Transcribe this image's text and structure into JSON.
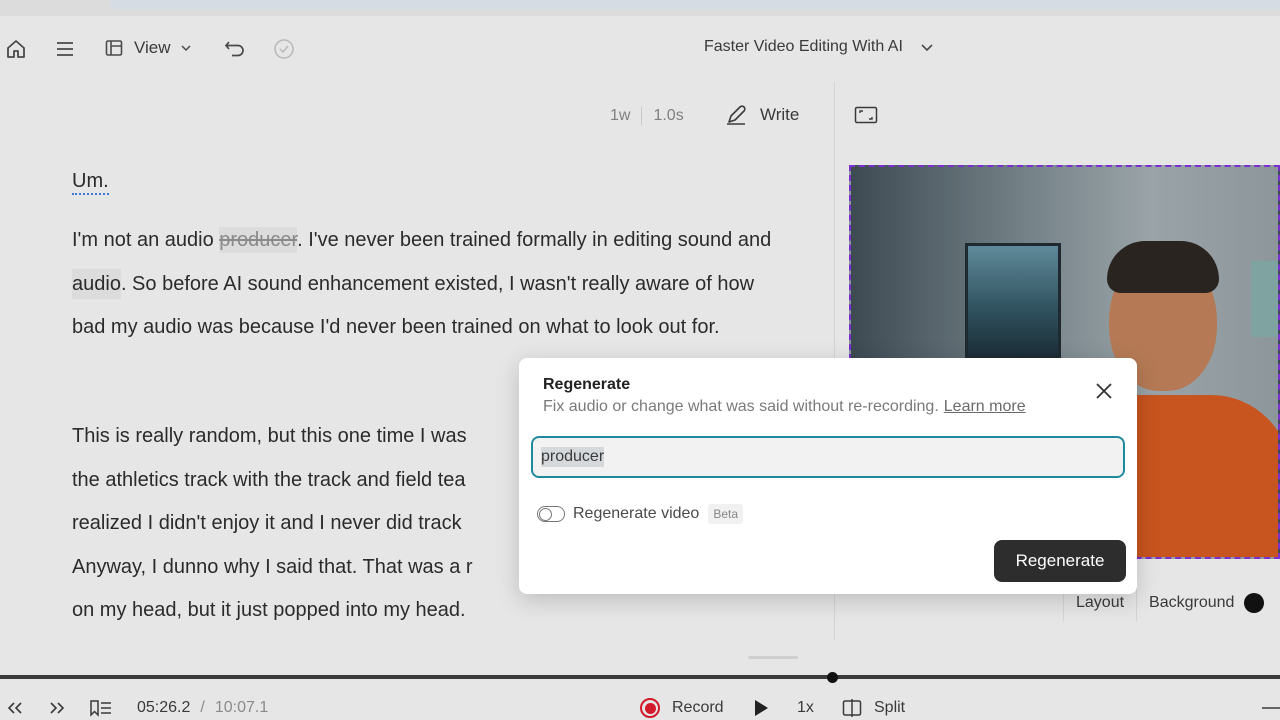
{
  "toolbar": {
    "view_label": "View",
    "project_title": "Faster Video Editing With AI"
  },
  "editor": {
    "word_count": "1w",
    "duration": "1.0s",
    "write_label": "Write",
    "line_um": "Um.",
    "para1_before": "I'm not an audio ",
    "para1_struck": "producer",
    "para1_mid": ". I've never been trained formally in editing sound and ",
    "para1_hl": "audio",
    "para1_after": ". So before AI sound enhancement existed, I wasn't really aware of how bad my audio was because I'd never been trained on what to look out for.",
    "para2": "This is really random, but this one time I was\nthe athletics track with the track and field tea\nrealized I didn't enjoy it and I never did track\nAnyway, I dunno why I said that. That was a r\non my head, but it just popped into my head."
  },
  "preview": {
    "layout_label": "Layout",
    "background_label": "Background",
    "background_color": "#111111"
  },
  "modal": {
    "title": "Regenerate",
    "subtitle": "Fix audio or change what was said without re-recording.",
    "learn_more": "Learn more",
    "input_value": "producer",
    "toggle_label": "Regenerate video",
    "beta_badge": "Beta",
    "button_label": "Regenerate",
    "accent_color": "#1f8a9c"
  },
  "playback": {
    "current_time": "05:26.2",
    "separator": "/",
    "total_time": "10:07.1",
    "record_label": "Record",
    "speed_label": "1x",
    "split_label": "Split",
    "progress_fraction": 0.65
  }
}
